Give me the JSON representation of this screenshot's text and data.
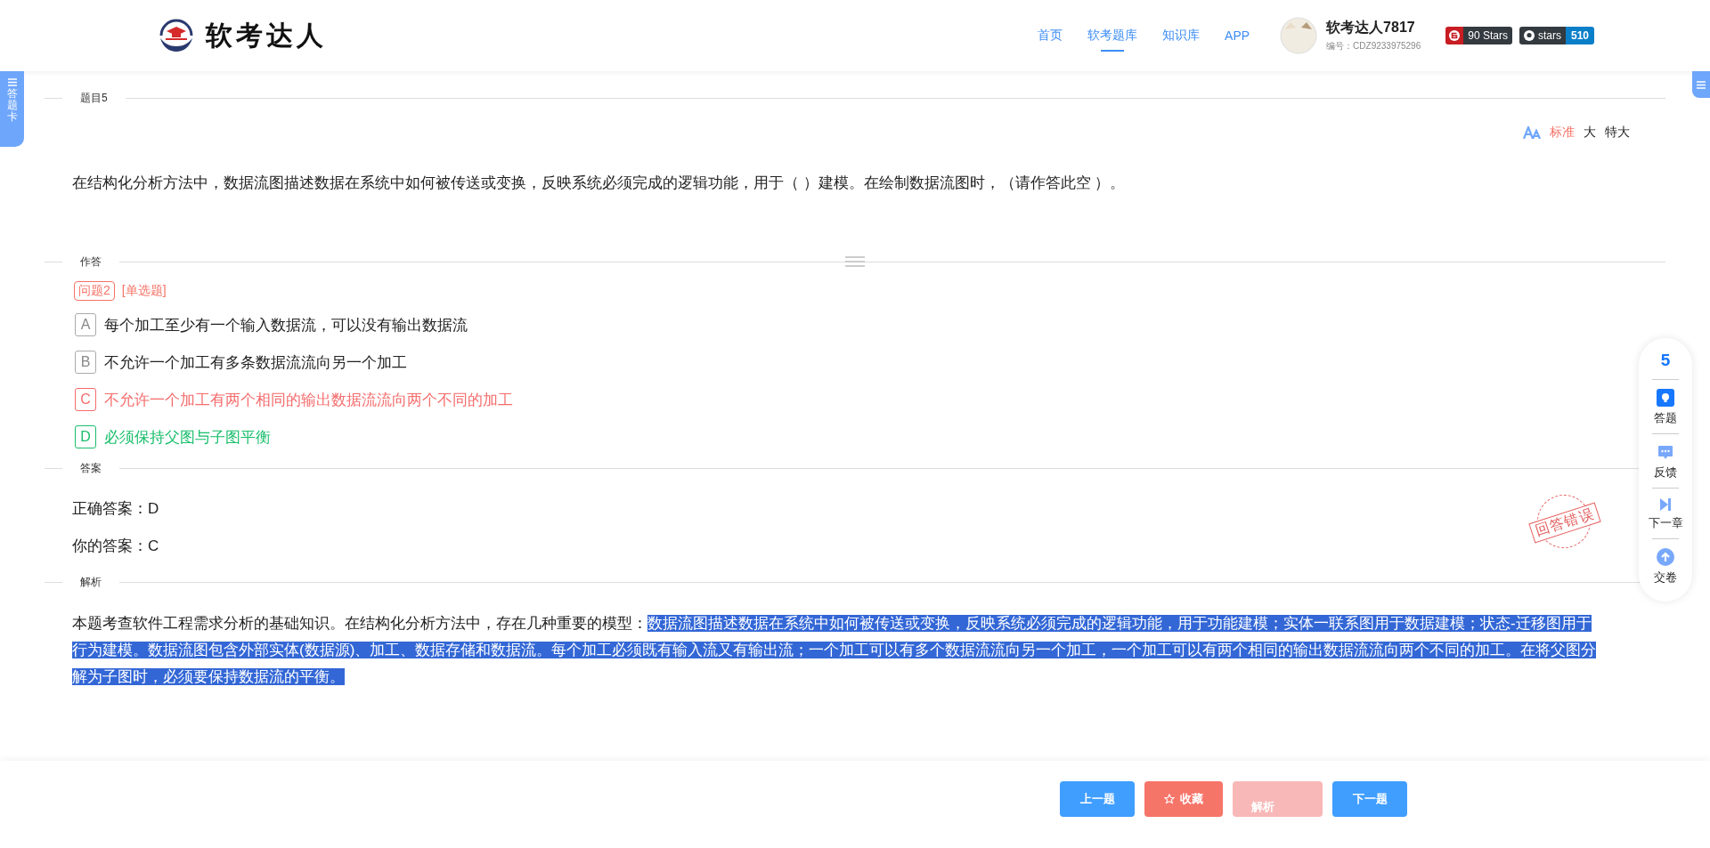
{
  "header": {
    "logo_text": "软考达人",
    "nav": [
      {
        "label": "首页",
        "selected": false
      },
      {
        "label": "软考题库",
        "selected": true
      },
      {
        "label": "知识库",
        "selected": false
      },
      {
        "label": "APP",
        "selected": false
      }
    ],
    "user": {
      "name": "软考达人7817",
      "id_label": "编号：CDZ9233975296"
    },
    "badges": [
      {
        "kind": "gitee",
        "label": "90 Stars"
      },
      {
        "kind": "github",
        "label": "stars",
        "count": "510"
      }
    ]
  },
  "side_tab": {
    "label": "答题卡"
  },
  "question": {
    "section": "题目5",
    "font_sizes": [
      {
        "label": "标准",
        "selected": true
      },
      {
        "label": "大",
        "selected": false
      },
      {
        "label": "特大",
        "selected": false
      }
    ],
    "text": "在结构化分析方法中，数据流图描述数据在系统中如何被传送或变换，反映系统必须完成的逻辑功能，用于（ ）建模。在绘制数据流图时，（请作答此空 ）。"
  },
  "answer_area": {
    "section": "作答",
    "tags": [
      "问题2",
      "[单选题]"
    ],
    "options": [
      {
        "letter": "A",
        "text": "每个加工至少有一个输入数据流，可以没有输出数据流",
        "kind": "plain"
      },
      {
        "letter": "B",
        "text": "不允许一个加工有多条数据流流向另一个加工",
        "kind": "plain"
      },
      {
        "letter": "C",
        "text": "不允许一个加工有两个相同的输出数据流流向两个不同的加工",
        "kind": "wrong"
      },
      {
        "letter": "D",
        "text": "必须保持父图与子图平衡",
        "kind": "correct"
      }
    ]
  },
  "answer": {
    "section": "答案",
    "correct": "正确答案：D",
    "yours": "你的答案：C",
    "stamp": "回答错误"
  },
  "analysis": {
    "section": "解析",
    "segments": [
      {
        "text": "本题考查软件工程需求分析的基础知识。在结构化分析方法中，存在几种重要的模型：",
        "highlighted": false
      },
      {
        "text": "数据流图描述数据在系统中如何被传送或变换，反映系统必须完成的逻辑功能，用于功能建模；实体一联系图用于数据建模；状态-迁移图用于行为建模。数据流图包含外部实体(数据源)、加工、数据存储和数据流。每个加工必须既有输入流又有输出流；一个加工可以有多个数据流流向另一个加工，一个加工可以有两个相同的输出数据流流向两个不同的加工。在将父图分解为子图时，必须要保持数据流的平衡。",
        "highlighted": true
      }
    ]
  },
  "float_panel": {
    "number": "5",
    "items": [
      {
        "kind": "answer",
        "label": "答题"
      },
      {
        "kind": "feedback",
        "label": "反馈"
      },
      {
        "kind": "next",
        "label": "下一章"
      },
      {
        "kind": "submit",
        "label": "交卷"
      }
    ]
  },
  "footer": {
    "buttons": [
      {
        "kind": "primary",
        "label": "上一题",
        "disabled": false
      },
      {
        "kind": "favorite",
        "label": "收藏",
        "disabled": false
      },
      {
        "kind": "analysis",
        "label": "解析",
        "disabled": true
      },
      {
        "kind": "primary",
        "label": "下一题",
        "disabled": false
      }
    ]
  }
}
